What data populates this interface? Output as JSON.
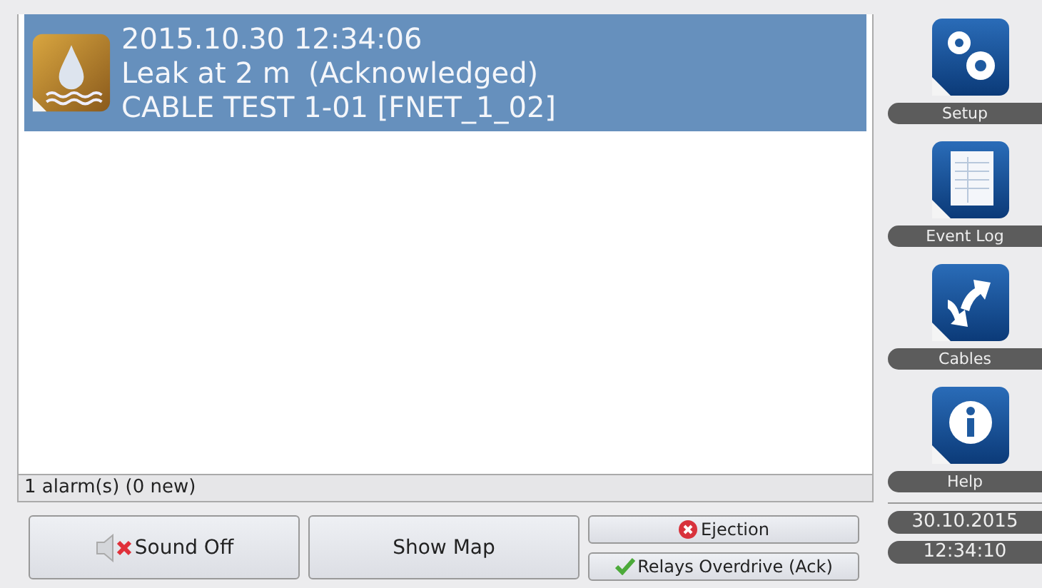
{
  "alarms": [
    {
      "kind": "leak",
      "selected": true,
      "lines": [
        "2015.10.30 12:34:06",
        "Leak at 2 m  (Acknowledged)",
        "CABLE TEST 1-01 [FNET_1_02]"
      ]
    }
  ],
  "status_bar": "1 alarm(s) (0 new)",
  "buttons": [
    {
      "kind": "sound",
      "label": "Sound Off"
    },
    {
      "kind": "plain",
      "label": "Show Map"
    }
  ],
  "small_buttons": [
    {
      "kind": "error",
      "label": "Ejection"
    },
    {
      "kind": "ok",
      "label": "Relays Overdrive (Ack)"
    }
  ],
  "sidebar": {
    "items": [
      {
        "kind": "gears",
        "label": "Setup"
      },
      {
        "kind": "log",
        "label": "Event Log"
      },
      {
        "kind": "swap",
        "label": "Cables"
      },
      {
        "kind": "info",
        "label": "Help"
      }
    ],
    "date": "30.10.2015",
    "time": "12:34:10"
  }
}
